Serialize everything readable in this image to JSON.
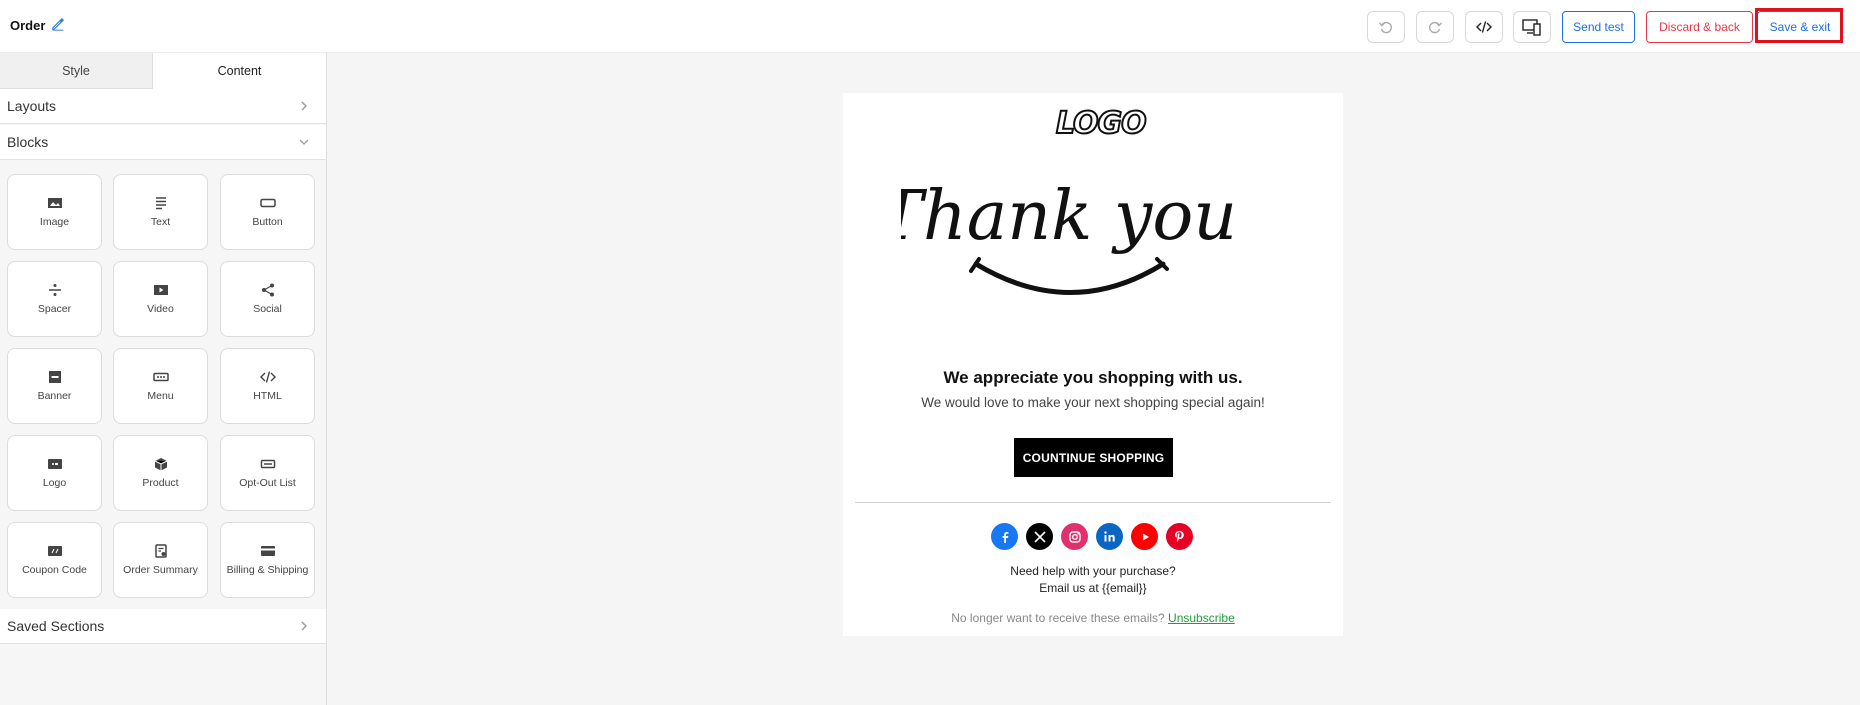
{
  "header": {
    "title": "Order",
    "buttons": {
      "send_test": "Send test",
      "discard": "Discard & back",
      "save": "Save & exit"
    }
  },
  "sidebar": {
    "tabs": [
      "Style",
      "Content"
    ],
    "active_tab": "Content",
    "sections": {
      "layouts": "Layouts",
      "blocks": "Blocks",
      "saved": "Saved Sections"
    },
    "blocks": [
      {
        "label": "Image",
        "icon": "image-icon"
      },
      {
        "label": "Text",
        "icon": "text-icon"
      },
      {
        "label": "Button",
        "icon": "button-icon"
      },
      {
        "label": "Spacer",
        "icon": "spacer-icon"
      },
      {
        "label": "Video",
        "icon": "video-icon"
      },
      {
        "label": "Social",
        "icon": "share-icon"
      },
      {
        "label": "Banner",
        "icon": "banner-icon"
      },
      {
        "label": "Menu",
        "icon": "menu-icon"
      },
      {
        "label": "HTML",
        "icon": "code-icon"
      },
      {
        "label": "Logo",
        "icon": "logo-icon"
      },
      {
        "label": "Product",
        "icon": "product-icon"
      },
      {
        "label": "Opt-Out List",
        "icon": "opt-out-icon"
      },
      {
        "label": "Coupon Code",
        "icon": "coupon-icon"
      },
      {
        "label": "Order Summary",
        "icon": "order-summary-icon"
      },
      {
        "label": "Billing & Shipping",
        "icon": "billing-icon"
      }
    ]
  },
  "email": {
    "logo_text": "LOGO",
    "hero_text": "Thank you!",
    "headline": "We appreciate you shopping with us.",
    "subline": "We would love to make your next shopping special again!",
    "cta": "COUNTINUE SHOPPING",
    "socials": [
      {
        "name": "facebook",
        "color": "#1877f2"
      },
      {
        "name": "x",
        "color": "#000000"
      },
      {
        "name": "instagram",
        "color": "#e1306c"
      },
      {
        "name": "linkedin",
        "color": "#0a66c2"
      },
      {
        "name": "youtube",
        "color": "#ff0000"
      },
      {
        "name": "pinterest",
        "color": "#e60023"
      }
    ],
    "help_line1": "Need help with your purchase?",
    "help_line2": "Email us at {{email}}",
    "unsubscribe_prefix": "No longer want to receive these emails?",
    "unsubscribe_link": "Unsubscribe"
  },
  "colors": {
    "accent": "#1a6fe0",
    "danger": "#e2394c",
    "highlight": "#e0101c"
  }
}
